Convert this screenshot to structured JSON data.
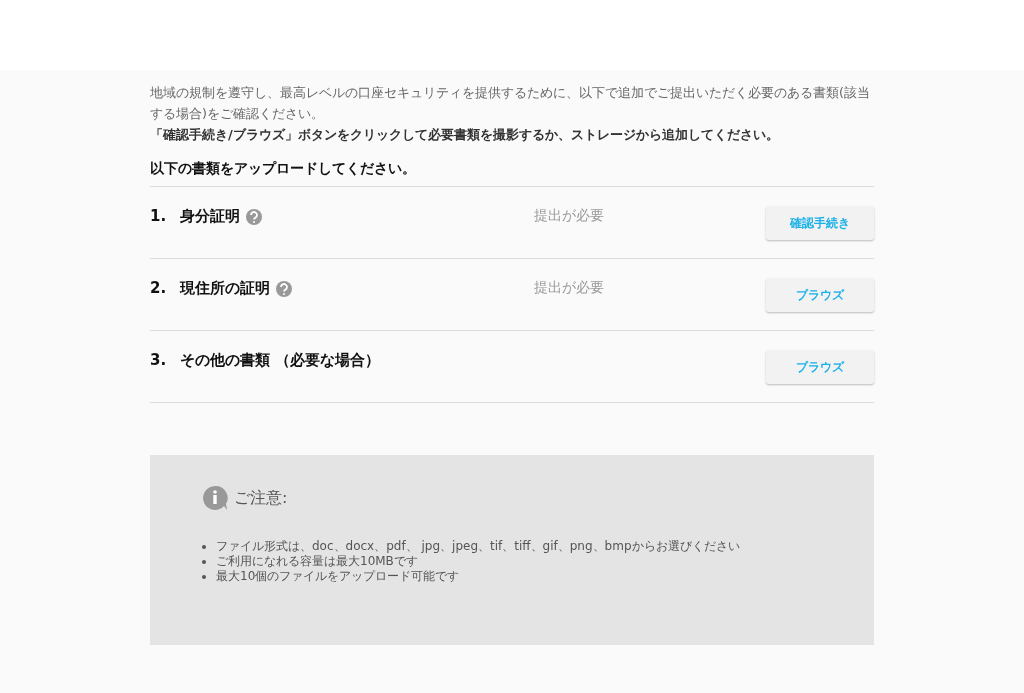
{
  "intro": {
    "paragraph": "地域の規制を遵守し、最高レベルの口座セキュリティを提供するために、以下で追加でご提出いただく必要のある書類(該当する場合)をご確認ください。",
    "instruction": "「確認手続き/ブラウズ」ボタンをクリックして必要書類を撮影するか、ストレージから追加してください。"
  },
  "heading": "以下の書類をアップロードしてください。",
  "documents": [
    {
      "number": "1.",
      "title": "身分証明",
      "help": true,
      "status": "提出が必要",
      "button": "確認手続き"
    },
    {
      "number": "2.",
      "title": "現住所の証明",
      "help": true,
      "status": "提出が必要",
      "button": "ブラウズ"
    },
    {
      "number": "3.",
      "title": "その他の書類 （必要な場合）",
      "help": false,
      "button": "ブラウズ"
    }
  ],
  "notice": {
    "title": "ご注意:",
    "items": [
      "ファイル形式は、doc、docx、pdf、 jpg、jpeg、tif、tiff、gif、png、bmpからお選びください",
      "ご利用になれる容量は最大10MBです",
      "最大10個のファイルをアップロード可能です"
    ]
  }
}
